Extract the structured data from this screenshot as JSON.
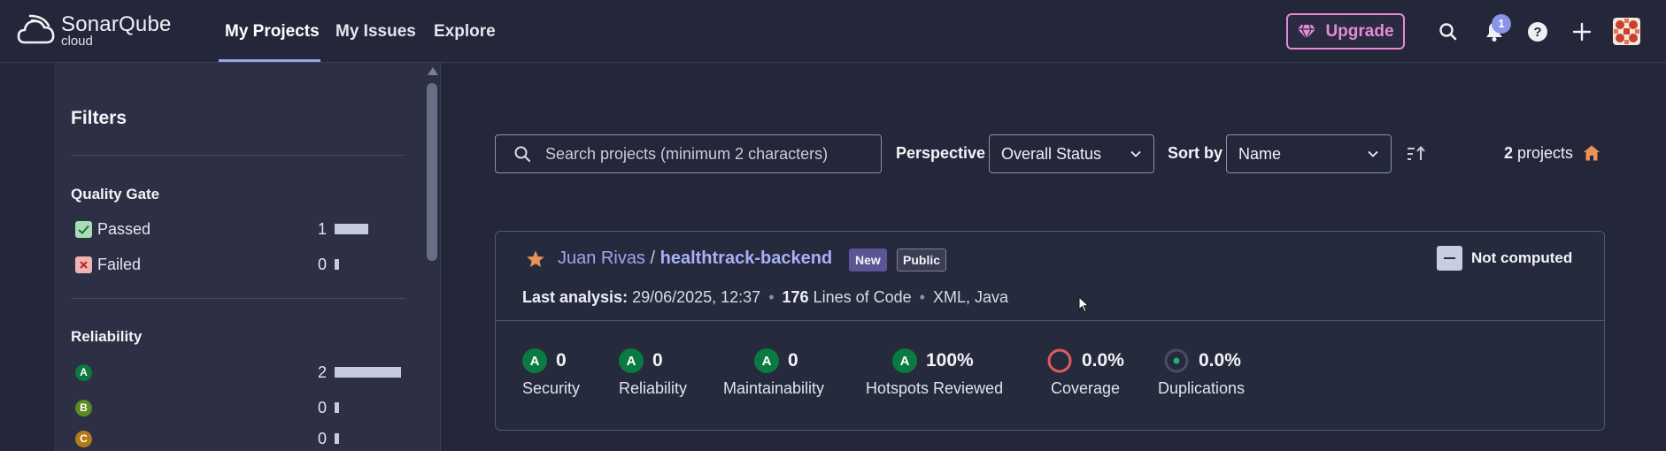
{
  "app": {
    "name": "SonarQube",
    "sub": "cloud"
  },
  "nav": {
    "items": [
      {
        "label": "My Projects",
        "active": true
      },
      {
        "label": "My Issues",
        "active": false
      },
      {
        "label": "Explore",
        "active": false
      }
    ]
  },
  "topbar": {
    "upgrade_label": "Upgrade",
    "notification_count": "1",
    "icons": [
      "search-icon",
      "bell-icon",
      "help-icon",
      "plus-icon",
      "avatar"
    ]
  },
  "filters": {
    "title": "Filters",
    "quality_gate": {
      "title": "Quality Gate",
      "items": [
        {
          "label": "Passed",
          "count": "1",
          "fraction": 0.5
        },
        {
          "label": "Failed",
          "count": "0",
          "fraction": 0
        }
      ]
    },
    "reliability": {
      "title": "Reliability",
      "items": [
        {
          "grade": "A",
          "count": "2",
          "fraction": 1.0,
          "color": "#0b7a42"
        },
        {
          "grade": "B",
          "count": "0",
          "fraction": 0,
          "color": "#5b8a1f"
        },
        {
          "grade": "C",
          "count": "0",
          "fraction": 0,
          "color": "#b37a16"
        }
      ]
    }
  },
  "toolbar": {
    "search_placeholder": "Search projects (minimum 2 characters)",
    "perspective_label": "Perspective",
    "perspective_value": "Overall Status",
    "sortby_label": "Sort by",
    "sortby_value": "Name",
    "count_number": "2",
    "count_label": " projects"
  },
  "project": {
    "org": "Juan Rivas",
    "separator": " / ",
    "name": "healthtrack-backend",
    "tag_new": "New",
    "tag_public": "Public",
    "quality_gate": "Not computed",
    "last_analysis_label": "Last analysis:",
    "last_analysis_value": " 29/06/2025, 12:37 ",
    "loc_value": "176",
    "loc_label": " Lines of Code ",
    "languages": " XML, Java",
    "metrics": [
      {
        "name": "Security",
        "grade": "A",
        "value": "0"
      },
      {
        "name": "Reliability",
        "grade": "A",
        "value": "0"
      },
      {
        "name": "Maintainability",
        "grade": "A",
        "value": "0"
      },
      {
        "name": "Hotspots Reviewed",
        "grade": "A",
        "value": "100%"
      },
      {
        "name": "Coverage",
        "value": "0.0%"
      },
      {
        "name": "Duplications",
        "value": "0.0%"
      }
    ]
  },
  "colors": {
    "accent": "#9aa2ee",
    "upgrade": "#e58ad7",
    "grade_a": "#0b7a42",
    "coverage_ring": "#e05c5c",
    "star": "#e9915a",
    "home": "#e9915a"
  }
}
